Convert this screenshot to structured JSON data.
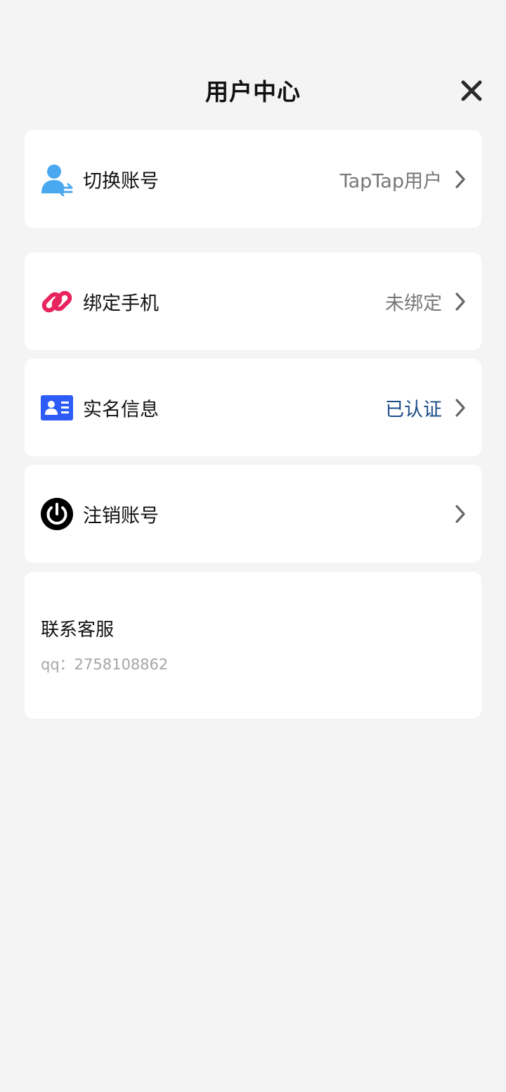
{
  "header": {
    "title": "用户中心"
  },
  "rows": [
    {
      "label": "切换账号",
      "value": "TapTap用户",
      "icon": "user-switch-icon"
    },
    {
      "label": "绑定手机",
      "value": "未绑定",
      "icon": "link-icon"
    },
    {
      "label": "实名信息",
      "value": "已认证",
      "icon": "id-card-icon"
    },
    {
      "label": "注销账号",
      "value": "",
      "icon": "power-icon"
    }
  ],
  "contact": {
    "title": "联系客服",
    "qq": "qq：2758108862"
  },
  "colors": {
    "background": "#f4f4f4",
    "card": "#ffffff",
    "verified": "#1c4e8a",
    "user_icon": "#4aa8f0",
    "link_icon": "#e8245e",
    "id_card_icon": "#2e5cf6"
  }
}
